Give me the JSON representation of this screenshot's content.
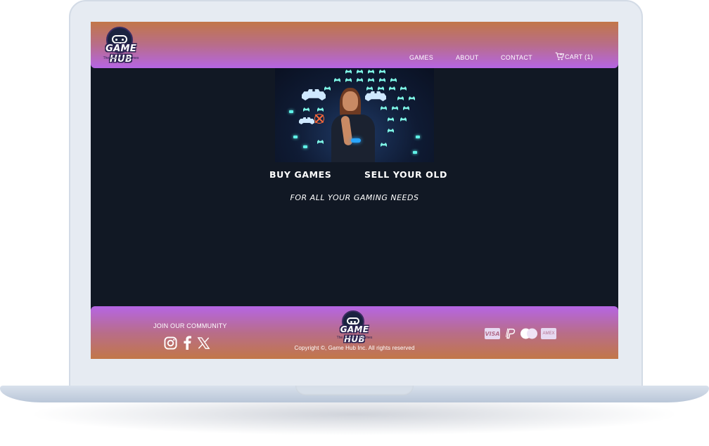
{
  "brand": {
    "name": "GAME HUB",
    "tagline": "The universe of games"
  },
  "nav": {
    "games": "GAMES",
    "about": "ABOUT",
    "contact": "CONTACT",
    "cart": "CART (1)"
  },
  "hero": {
    "image_icon": "space-invaders-photo",
    "buy_label": "BUY GAMES",
    "sell_label": "SELL YOUR OLD",
    "tagline": "FOR ALL YOUR GAMING NEEDS"
  },
  "footer": {
    "join_label": "JOIN OUR COMMUNITY",
    "social_icons": [
      "instagram-icon",
      "facebook-icon",
      "x-icon"
    ],
    "copyright": "Copyright ©, Game Hub Inc. All rights reserved",
    "payment_visa": "VISA",
    "payment_amex": "AMEX",
    "payment_icons": [
      "visa-icon",
      "paypal-icon",
      "mastercard-icon",
      "amex-icon"
    ]
  },
  "colors": {
    "header_top": "#c27748",
    "header_bottom": "#b565e4",
    "page_background": "#111824",
    "text": "#ffffff"
  }
}
